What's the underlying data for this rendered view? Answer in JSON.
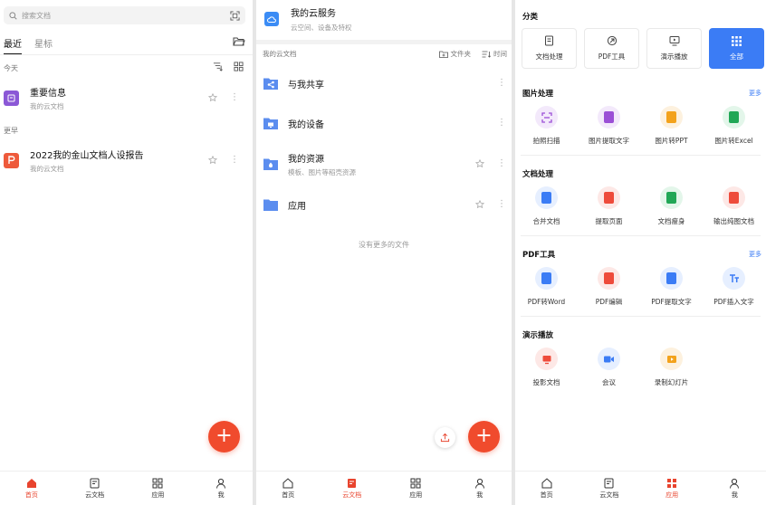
{
  "panel1": {
    "search_placeholder": "搜索文档",
    "tabs": [
      "最近",
      "星标"
    ],
    "section_today": "今天",
    "section_earlier": "更早",
    "files": [
      {
        "name": "重要信息",
        "location": "我的云文档",
        "icon": "note-icon",
        "color": "#8b58d6"
      },
      {
        "name": "2022我的金山文档人设报告",
        "location": "我的云文档",
        "icon": "pdf-icon",
        "color": "#ee5a3b"
      }
    ],
    "fab": "+"
  },
  "panel2": {
    "cloud_title": "我的云服务",
    "cloud_sub": "云空间、设备及特权",
    "section_label": "我的云文档",
    "new_folder": "文件夹",
    "sort_by": "时间",
    "items": [
      {
        "name": "与我共享",
        "sub": ""
      },
      {
        "name": "我的设备",
        "sub": ""
      },
      {
        "name": "我的资源",
        "sub": "模板、图片等稻壳资源"
      },
      {
        "name": "应用",
        "sub": ""
      }
    ],
    "no_more": "没有更多的文件",
    "fab": "+"
  },
  "panel3": {
    "category_title": "分类",
    "categories": [
      "文档处理",
      "PDF工具",
      "演示播放",
      "全部"
    ],
    "more": "更多",
    "image_section": "图片处理",
    "image_tools": [
      "拍照扫描",
      "图片提取文字",
      "图片转PPT",
      "图片转Excel"
    ],
    "doc_section": "文档处理",
    "doc_tools": [
      "合并文档",
      "提取页面",
      "文档瘦身",
      "输出纯图文档"
    ],
    "pdf_section": "PDF工具",
    "pdf_tools": [
      "PDF转Word",
      "PDF编辑",
      "PDF提取文字",
      "PDF插入文字"
    ],
    "present_section": "演示播放",
    "present_tools": [
      "投影文档",
      "会议",
      "录制幻灯片"
    ]
  },
  "nav": {
    "p1": [
      "首页",
      "云文档",
      "应用",
      "我"
    ],
    "p2": [
      "首页",
      "云文档",
      "应用",
      "我"
    ],
    "p3": [
      "首页",
      "云文档",
      "应用",
      "我"
    ]
  },
  "colors": {
    "accent": "#f04b2d",
    "blue": "#3b7cf5",
    "nav_active": "#e8442e"
  }
}
